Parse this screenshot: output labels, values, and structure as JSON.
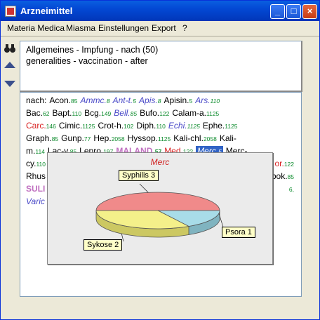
{
  "window": {
    "title": "Arzneimittel"
  },
  "titlebar": {
    "min": "_",
    "max": "□",
    "close": "×"
  },
  "menu": [
    "Materia Medica",
    "Miasma",
    "Einstellungen",
    "Export",
    "?"
  ],
  "menu_underline": [
    "M",
    "M",
    "E",
    "E",
    "?"
  ],
  "info": {
    "line1": "Allgemeines - Impfung - nach (50)",
    "line2": "generalities - vaccination - after"
  },
  "remedies": {
    "lines": [
      [
        {
          "t": "nach:",
          "s": "k"
        },
        {
          "t": "Acon.",
          "g": "85",
          "s": "k"
        },
        {
          "t": "Ammc.",
          "g": "8",
          "s": "i"
        },
        {
          "t": "Ant-t.",
          "g": "5",
          "s": "i"
        },
        {
          "t": "Apis.",
          "g": "8",
          "s": "i"
        },
        {
          "t": "Apisin.",
          "g": "5",
          "s": "k"
        },
        {
          "t": "Ars.",
          "g": "110",
          "s": "i"
        }
      ],
      [
        {
          "t": "Bac.",
          "g": "62",
          "s": "k"
        },
        {
          "t": "Bapt.",
          "g": "110",
          "s": "k"
        },
        {
          "t": "Bcg.",
          "g": "149",
          "s": "k"
        },
        {
          "t": "Bell.",
          "g": "85",
          "s": "i"
        },
        {
          "t": "Bufo.",
          "g": "122",
          "s": "k"
        },
        {
          "t": "Calam-a.",
          "g": "1125",
          "s": "k"
        }
      ],
      [
        {
          "t": "Carc.",
          "g": "146",
          "s": "r"
        },
        {
          "t": "Cimic.",
          "g": "1125",
          "s": "k"
        },
        {
          "t": "Crot-h.",
          "g": "102",
          "s": "k"
        },
        {
          "t": "Diph.",
          "g": "110",
          "s": "k"
        },
        {
          "t": "Echi.",
          "g": "1125",
          "s": "i"
        },
        {
          "t": "Ephe.",
          "g": "1125",
          "s": "k"
        }
      ],
      [
        {
          "t": "Graph.",
          "g": "85",
          "s": "k"
        },
        {
          "t": "Gunp.",
          "g": "77",
          "s": "k"
        },
        {
          "t": "Hep.",
          "g": "2058",
          "s": "k"
        },
        {
          "t": "Hyssop.",
          "g": "1125",
          "s": "k"
        },
        {
          "t": "Kali-chl.",
          "g": "2058",
          "s": "k"
        },
        {
          "t": "Kali-",
          "s": "k"
        }
      ],
      [
        {
          "t": "m.",
          "g": "114",
          "s": "k"
        },
        {
          "t": "Lac-v.",
          "g": "85",
          "s": "k"
        },
        {
          "t": "Lepro.",
          "g": "197",
          "s": "k"
        },
        {
          "t": "MALAND.",
          "g": "57",
          "s": "p"
        },
        {
          "t": "Med.",
          "g": "122",
          "s": "r"
        },
        {
          "t": "Merc.",
          "g": "5",
          "s": "sel"
        },
        {
          "t": "Merc-",
          "s": "k"
        }
      ],
      [
        {
          "t": "cy.",
          "g": "110",
          "s": "k"
        },
        {
          "t": "or.",
          "g": "122",
          "s": "r",
          "right": true
        }
      ],
      [
        {
          "t": "Rhus",
          "s": "k"
        },
        {
          "t": "bok.",
          "g": "85",
          "s": "k",
          "right": true
        }
      ],
      [
        {
          "t": "SULI",
          "s": "p"
        },
        {
          "t": "6,",
          "s": "g",
          "right": true
        }
      ],
      [
        {
          "t": "Varic",
          "s": "i"
        }
      ]
    ]
  },
  "chart_data": {
    "type": "pie",
    "title": "Merc",
    "categories": [
      "Syphilis",
      "Psora",
      "Sykose"
    ],
    "values": [
      3,
      1,
      2
    ],
    "labels": [
      "Syphilis 3",
      "Psora 1",
      "Sykose 2"
    ],
    "colors": [
      "#f08a8a",
      "#a8dce8",
      "#f4f08a"
    ]
  }
}
